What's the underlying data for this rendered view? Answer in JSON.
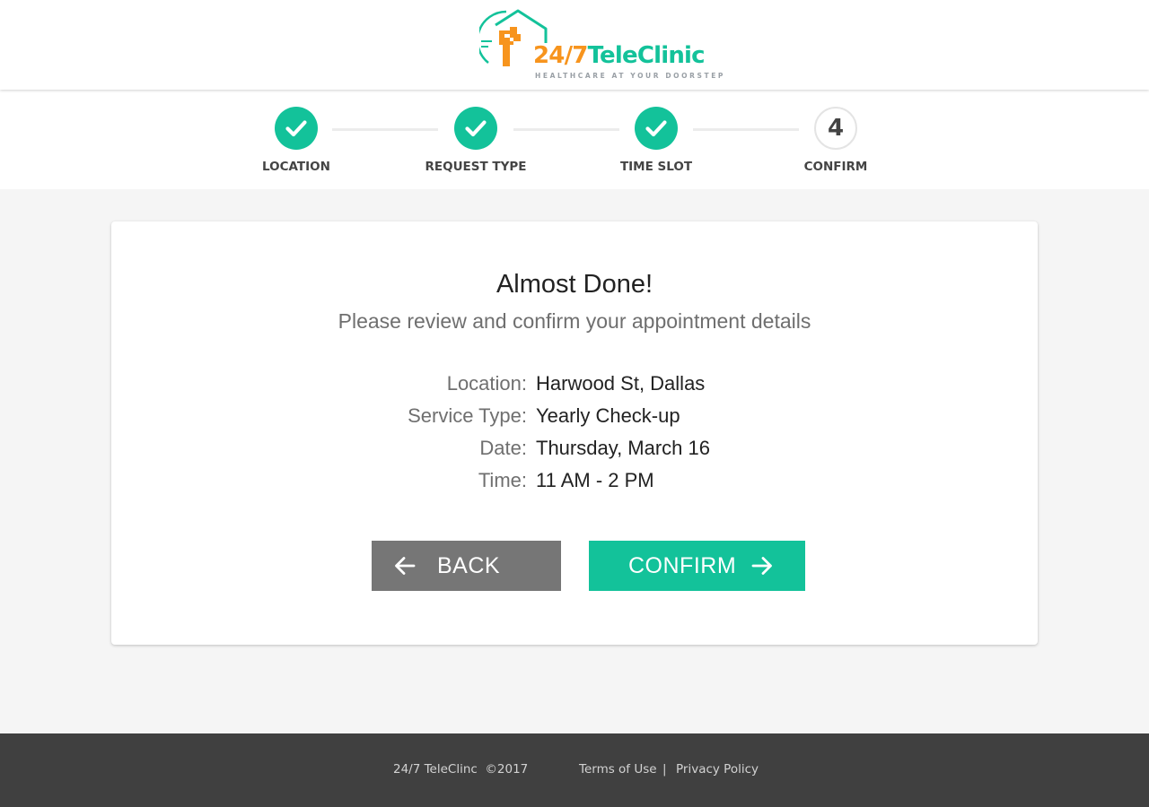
{
  "header": {
    "logo": {
      "name_part1": "24/7",
      "name_part2": "TeleClinic",
      "tagline": "HEALTHCARE AT YOUR DOORSTEP",
      "icon": "clinic-house-cross-logo",
      "colors": {
        "orange": "#f7941d",
        "green": "#13c29a"
      }
    }
  },
  "stepper": {
    "steps": [
      {
        "label": "LOCATION",
        "status": "complete",
        "icon": "check-icon"
      },
      {
        "label": "REQUEST TYPE",
        "status": "complete",
        "icon": "check-icon"
      },
      {
        "label": "TIME SLOT",
        "status": "complete",
        "icon": "check-icon"
      },
      {
        "label": "CONFIRM",
        "status": "current",
        "number": "4"
      }
    ],
    "colors": {
      "complete": "#13c29a",
      "line": "#ececec"
    }
  },
  "card": {
    "title": "Almost Done!",
    "subtitle": "Please review and confirm your appointment details",
    "details": [
      {
        "key": "Location:",
        "value": "Harwood St, Dallas"
      },
      {
        "key": "Service Type:",
        "value": "Yearly Check-up"
      },
      {
        "key": "Date:",
        "value": "Thursday, March 16"
      },
      {
        "key": "Time:",
        "value": "11 AM - 2 PM"
      }
    ],
    "back_button": {
      "label": "BACK",
      "icon": "arrow-left-icon",
      "color": "#767676"
    },
    "confirm_button": {
      "label": "CONFIRM",
      "icon": "arrow-right-icon",
      "color": "#13c29a"
    }
  },
  "footer": {
    "copyright": "24/7 TeleClinc  ©2017",
    "terms": "Terms of Use",
    "separator": "|",
    "privacy": "Privacy Policy",
    "background": "#404040"
  }
}
